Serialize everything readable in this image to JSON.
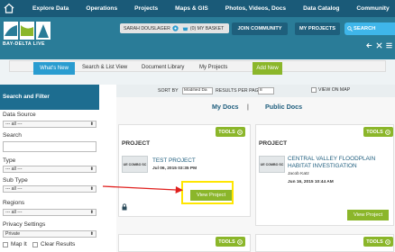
{
  "nav": {
    "items": [
      "Explore Data",
      "Operations",
      "Projects",
      "Maps & GIS",
      "Photos, Videos, Docs",
      "Data Catalog",
      "Community"
    ]
  },
  "header": {
    "logo_text": "BAY-DELTA LIVE",
    "user_name": "SARAH DOUSLAGER",
    "basket_label": "(0) MY BASKET",
    "join_label": "JOIN COMMUNITY",
    "my_projects_label": "MY PROJECTS",
    "search_label": "SEARCH"
  },
  "tabs": {
    "whats_new": "What's New",
    "search_list": "Search & List View",
    "doc_library": "Document Library",
    "my_projects": "My Projects",
    "add_new": "Add New"
  },
  "sidebar": {
    "heading": "Search and Filter",
    "data_source_label": "Data Source",
    "data_source_value": "--- all ---",
    "search_label": "Search",
    "type_label": "Type",
    "type_value": "--- all ---",
    "subtype_label": "Sub Type",
    "subtype_value": "--- all ---",
    "regions_label": "Regions",
    "regions_value": "--- all ---",
    "privacy_label": "Privacy Settings",
    "privacy_value": "Private",
    "map_it": "Map It",
    "clear_results": "Clear Results"
  },
  "sortbar": {
    "sort_by": "SORT BY",
    "sort_value": "Modified Da",
    "results_per_page": "RESULTS PER PAGE",
    "rpp_value": "8",
    "view_on_map": "VIEW ON MAP"
  },
  "doc_tabs": {
    "my_docs": "My Docs",
    "separator": "|",
    "public_docs": "Public Docs"
  },
  "cards": [
    {
      "type": "PROJECT",
      "tools": "TOOLS",
      "thumb_text": "UE COMBO SC",
      "title_lines": [
        "TEST PROJECT"
      ],
      "author": "",
      "date": "Jul 06, 2015 03:35 PM",
      "view_label": "View Project"
    },
    {
      "type": "PROJECT",
      "tools": "TOOLS",
      "thumb_text": "UE COMBO SC",
      "title_lines": [
        "CENTRAL VALLEY FLOODPLAIN",
        "HABITAT INVESTIGATION"
      ],
      "author": "Jacob Katz",
      "date": "Jun 16, 2015 10:44 AM",
      "view_label": "View Project"
    }
  ],
  "bottom_cards_tools": [
    "TOOLS",
    "TOOLS"
  ],
  "colors": {
    "nav_bg": "#1a5a78",
    "header_bg": "#2a7c98",
    "accent_green": "#8bb62a",
    "accent_blue": "#2a9cd0",
    "highlight_yellow": "#ffe600",
    "arrow_red": "#e0201e"
  }
}
